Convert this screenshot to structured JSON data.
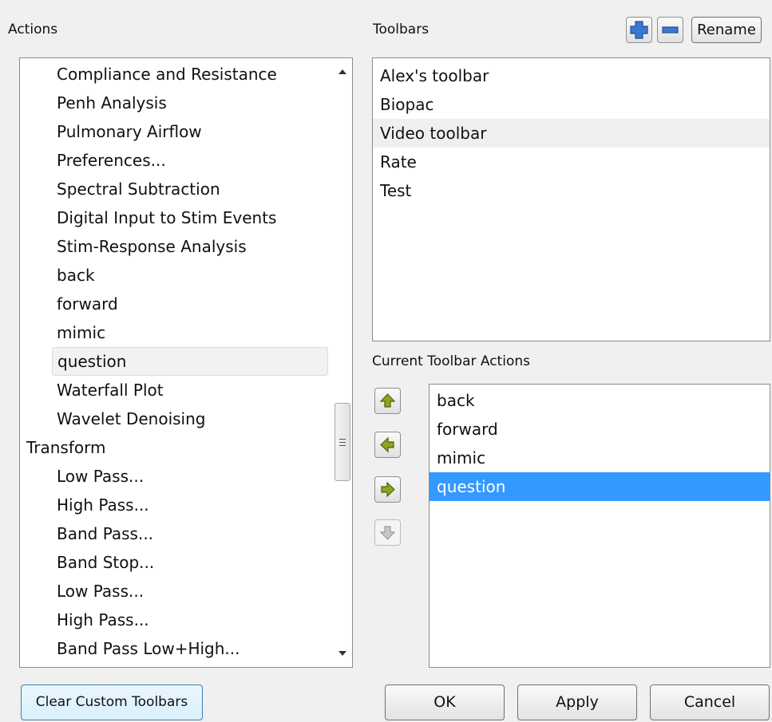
{
  "actions": {
    "label": "Actions",
    "items": [
      {
        "text": "Compliance and Resistance",
        "level": "child"
      },
      {
        "text": "Penh Analysis",
        "level": "child"
      },
      {
        "text": "Pulmonary Airflow",
        "level": "child"
      },
      {
        "text": "Preferences...",
        "level": "child"
      },
      {
        "text": "Spectral Subtraction",
        "level": "child"
      },
      {
        "text": "Digital Input to Stim Events",
        "level": "child"
      },
      {
        "text": "Stim-Response Analysis",
        "level": "child"
      },
      {
        "text": "back",
        "level": "child"
      },
      {
        "text": "forward",
        "level": "child"
      },
      {
        "text": "mimic",
        "level": "child"
      },
      {
        "text": "question",
        "level": "child",
        "state": "hover"
      },
      {
        "text": "Waterfall Plot",
        "level": "child"
      },
      {
        "text": "Wavelet Denoising",
        "level": "child"
      },
      {
        "text": "Transform",
        "level": "top"
      },
      {
        "text": "Low Pass...",
        "level": "child"
      },
      {
        "text": "High Pass...",
        "level": "child"
      },
      {
        "text": "Band Pass...",
        "level": "child"
      },
      {
        "text": "Band Stop...",
        "level": "child"
      },
      {
        "text": "Low Pass...",
        "level": "child"
      },
      {
        "text": "High Pass...",
        "level": "child"
      },
      {
        "text": "Band Pass Low+High...",
        "level": "child"
      }
    ]
  },
  "toolbars": {
    "label": "Toolbars",
    "add_icon": "plus-icon",
    "remove_icon": "minus-icon",
    "rename_label": "Rename",
    "items": [
      {
        "text": "Alex's toolbar"
      },
      {
        "text": "Biopac"
      },
      {
        "text": "Video toolbar",
        "state": "highlighted"
      },
      {
        "text": "Rate"
      },
      {
        "text": "Test"
      }
    ]
  },
  "current": {
    "label": "Current Toolbar Actions",
    "items": [
      {
        "text": "back"
      },
      {
        "text": "forward"
      },
      {
        "text": "mimic"
      },
      {
        "text": "question",
        "state": "selected"
      }
    ],
    "move_buttons": [
      "arrow-up-icon",
      "arrow-left-icon",
      "arrow-right-icon",
      "arrow-down-icon"
    ]
  },
  "buttons": {
    "clear": "Clear Custom Toolbars",
    "ok": "OK",
    "apply": "Apply",
    "cancel": "Cancel"
  },
  "colors": {
    "selection": "#3399ff",
    "arrow_fill": "#8aa61e",
    "plus_blue": "#3a78d0"
  }
}
